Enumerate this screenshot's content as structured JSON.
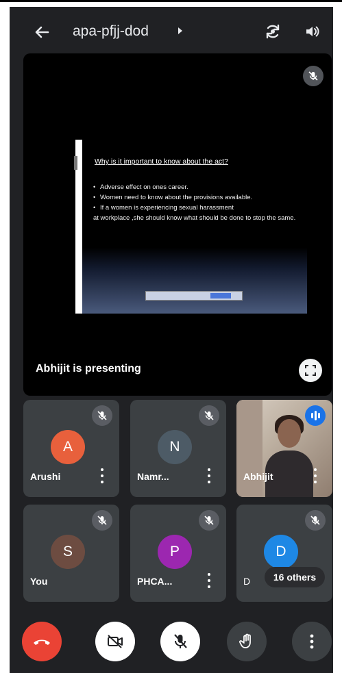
{
  "header": {
    "title": "apa-pfjj-dod",
    "back_icon": "arrow-back-icon",
    "switch_camera_icon": "flip-camera-icon",
    "audio_icon": "volume-icon"
  },
  "presentation": {
    "slide": {
      "title": "Why is it important to know about the act?",
      "bullets": [
        "Adverse effect on ones career.",
        "Women need to know about the  provisions available.",
        "If a women is experiencing sexual harassment"
      ],
      "continuation": "at workplace ,she should know what should be done to stop the same."
    },
    "presenter_label": "Abhijit is presenting",
    "fullscreen_icon": "fullscreen-icon"
  },
  "participants": [
    {
      "name": "Arushi",
      "initial": "A",
      "color": "#e8603c",
      "muted": true
    },
    {
      "name": "Namr...",
      "initial": "N",
      "color": "#4d5b66",
      "muted": true
    },
    {
      "name": "Abhijit",
      "initial": "",
      "video": true,
      "speaking": true
    },
    {
      "name": "You",
      "initial": "S",
      "color": "#6d4c41",
      "muted": true
    },
    {
      "name": "PHCA...",
      "initial": "P",
      "color": "#9c27b0",
      "muted": true
    },
    {
      "name": "D",
      "initial": "D",
      "color": "#1e88e5",
      "muted": true
    }
  ],
  "others_badge": "16 others",
  "controls": {
    "end_call": {
      "icon": "end-call-icon",
      "color": "#ea4335"
    },
    "camera": {
      "icon": "camera-off-icon",
      "color": "#ffffff"
    },
    "mic": {
      "icon": "mic-off-icon",
      "color": "#ffffff"
    },
    "raise_hand": {
      "icon": "raise-hand-icon",
      "color": "#3c4043"
    },
    "more": {
      "icon": "more-options-icon",
      "color": "#3c4043"
    }
  },
  "colors": {
    "background": "#202124",
    "tile": "#3c4043",
    "accent": "#1a73e8"
  }
}
